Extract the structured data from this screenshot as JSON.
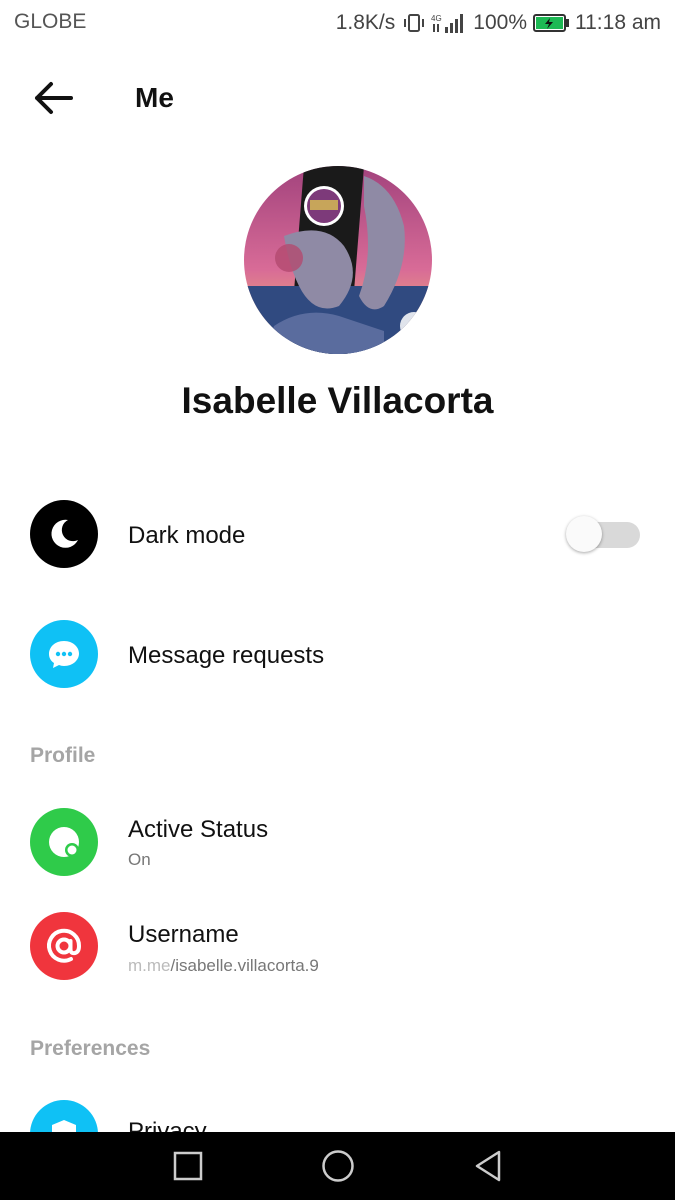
{
  "status_bar": {
    "carrier": "GLOBE",
    "net_speed": "1.8K/s",
    "battery_percent": "100%",
    "time": "11:18 am",
    "battery_color": "#1db954"
  },
  "header": {
    "back_icon": "arrow-left-icon",
    "title": "Me"
  },
  "profile": {
    "name": "Isabelle Villacorta"
  },
  "rows": {
    "dark_mode": {
      "label": "Dark mode",
      "icon": "moon-icon",
      "icon_bg": "#000000",
      "enabled": false
    },
    "message_requests": {
      "label": "Message requests",
      "icon": "chat-bubble-icon",
      "icon_bg": "#0fc1f5"
    }
  },
  "sections": {
    "profile": {
      "header": "Profile",
      "active_status": {
        "label": "Active Status",
        "value": "On",
        "icon": "active-status-icon",
        "icon_bg": "#2fcb4a"
      },
      "username": {
        "label": "Username",
        "prefix": "m.me",
        "value": "/isabelle.villacorta.9",
        "icon": "at-sign-icon",
        "icon_bg": "#f0353d"
      }
    },
    "preferences": {
      "header": "Preferences",
      "privacy": {
        "label": "Privacy",
        "icon": "shield-icon",
        "icon_bg": "#0fc1f5"
      }
    }
  },
  "nav_bar": {
    "recents_icon": "square-icon",
    "home_icon": "circle-icon",
    "back_icon": "triangle-back-icon"
  }
}
